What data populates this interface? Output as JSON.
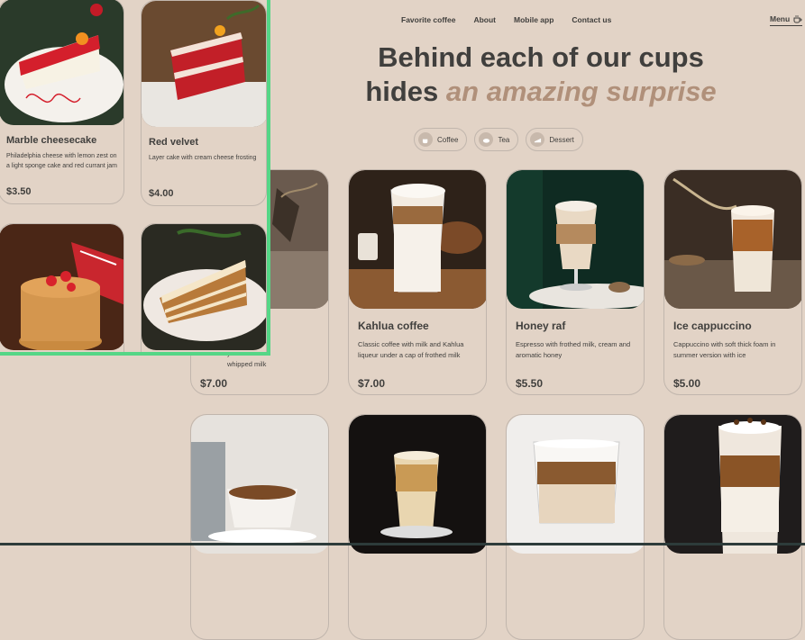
{
  "nav": {
    "items": [
      "Favorite coffee",
      "About",
      "Mobile app",
      "Contact us"
    ],
    "menu_label": "Menu"
  },
  "hero": {
    "line1": "Behind each of our cups",
    "line2_plain": "hides ",
    "line2_accent": "an amazing surprise"
  },
  "tabs": [
    {
      "label": "Coffee",
      "icon": "coffee-cup-icon"
    },
    {
      "label": "Tea",
      "icon": "tea-icon"
    },
    {
      "label": "Dessert",
      "icon": "dessert-icon"
    }
  ],
  "products": [
    {
      "name": "",
      "desc": "with\ny and\nwhipped milk",
      "price": "$7.00"
    },
    {
      "name": "Kahlua coffee",
      "desc": "Classic coffee with milk and Kahlua liqueur under a cap of frothed milk",
      "price": "$7.00"
    },
    {
      "name": "Honey raf",
      "desc": "Espresso with frothed milk, cream and aromatic honey",
      "price": "$5.50"
    },
    {
      "name": "Ice cappuccino",
      "desc": "Cappuccino with soft thick foam in summer version with ice",
      "price": "$5.00"
    }
  ],
  "overlay_products": [
    {
      "name": "Marble cheesecake",
      "desc": "Philadelphia cheese with lemon zest on a light sponge cake and red currant jam",
      "price": "$3.50"
    },
    {
      "name": "Red velvet",
      "desc": "Layer cake with cream cheese frosting",
      "price": "$4.00"
    }
  ],
  "colors": {
    "background": "#e2d3c6",
    "text": "#403f3d",
    "accent": "#b0907a",
    "highlight": "#55d686"
  }
}
